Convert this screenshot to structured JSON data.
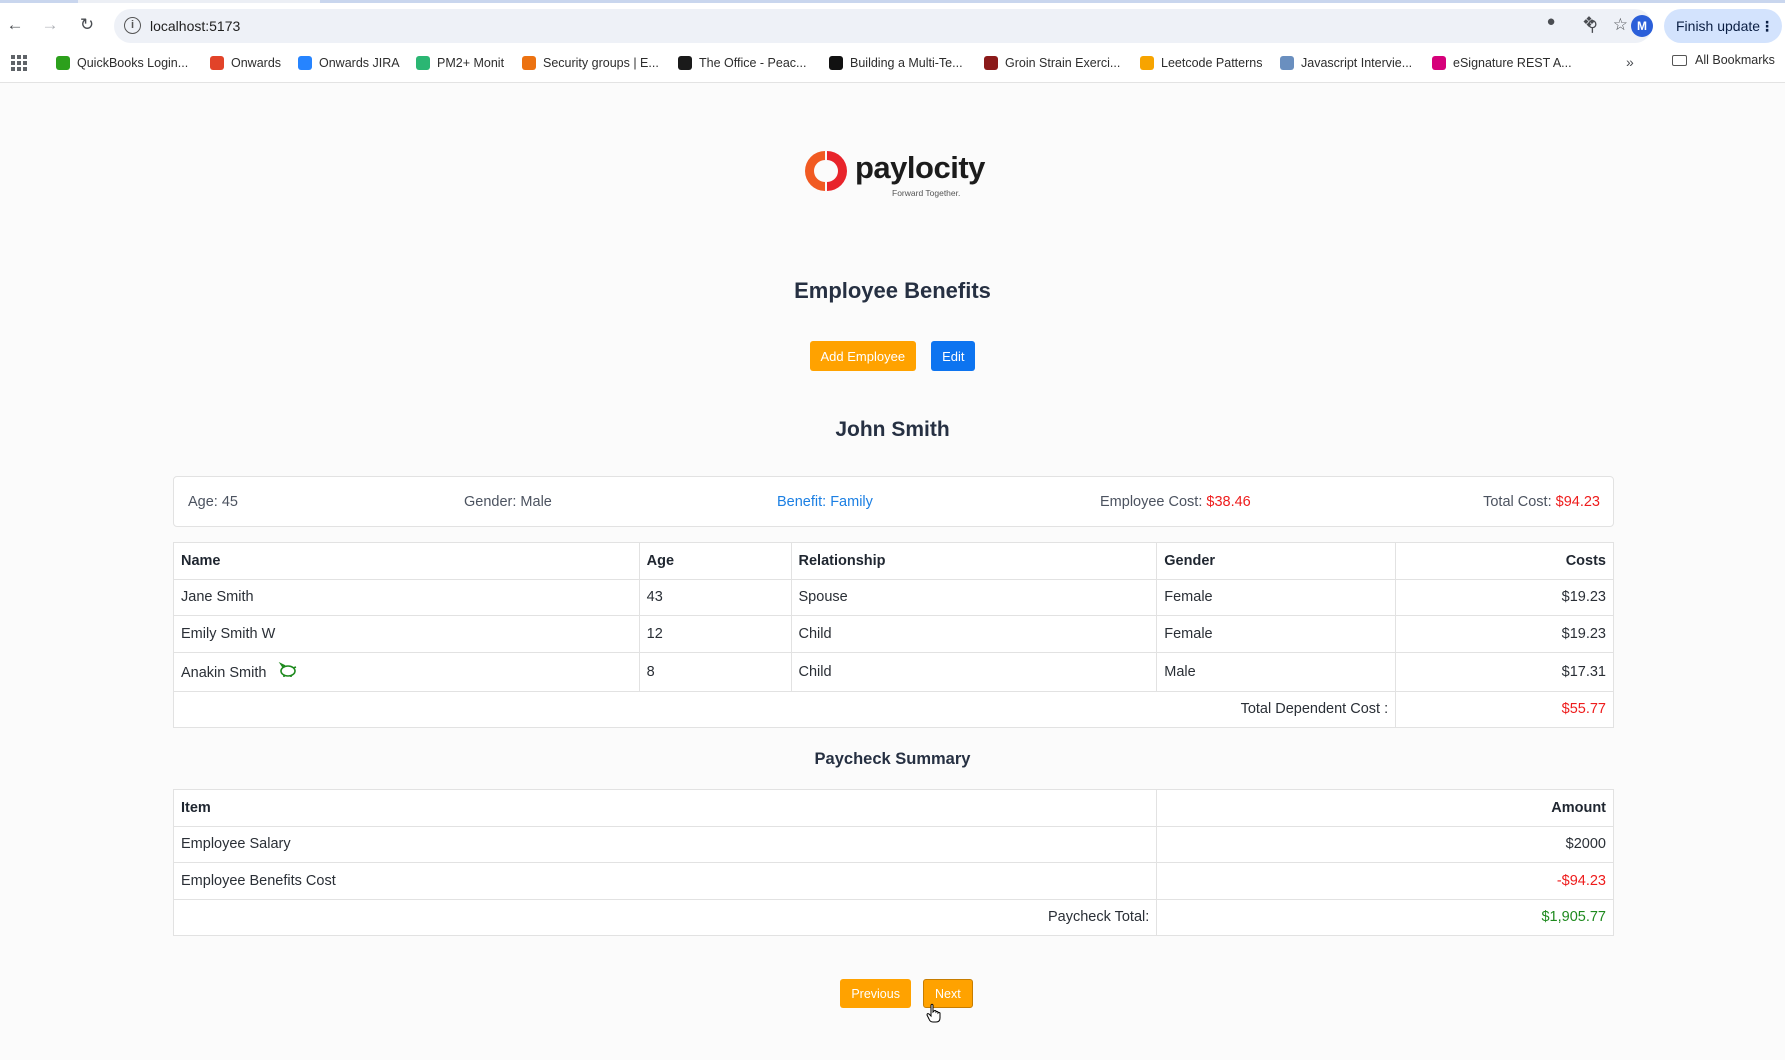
{
  "browser": {
    "url": "localhost:5173",
    "update_label": "Finish update",
    "profile_initial": "M",
    "bookmarks": [
      {
        "label": "QuickBooks Login...",
        "color": "#2ca01c"
      },
      {
        "label": "Onwards",
        "color": "#e24329"
      },
      {
        "label": "Onwards JIRA",
        "color": "#2684ff"
      },
      {
        "label": "PM2+ Monit",
        "color": "#2bb673"
      },
      {
        "label": "Security groups | E...",
        "color": "#ec7211"
      },
      {
        "label": "The Office - Peac...",
        "color": "#1a1a1a"
      },
      {
        "label": "Building a Multi-Te...",
        "color": "#111111"
      },
      {
        "label": "Groin Strain Exerci...",
        "color": "#8b1a1a"
      },
      {
        "label": "Leetcode Patterns",
        "color": "#f7a400"
      },
      {
        "label": "Javascript Intervie...",
        "color": "#6a8fbf"
      },
      {
        "label": "eSignature REST A...",
        "color": "#d6007a"
      }
    ],
    "all_bookmarks_label": "All Bookmarks"
  },
  "logo": {
    "brand": "paylocity",
    "tagline": "Forward Together."
  },
  "page": {
    "title": "Employee Benefits",
    "add_employee_label": "Add Employee",
    "edit_label": "Edit"
  },
  "employee": {
    "name": "John Smith",
    "age_label": "Age: 45",
    "gender_label": "Gender: Male",
    "benefit_label": "Benefit: Family",
    "employee_cost_label": "Employee Cost:",
    "employee_cost_value": "$38.46",
    "total_cost_label": "Total Cost:",
    "total_cost_value": "$94.23"
  },
  "dependents": {
    "headers": {
      "name": "Name",
      "age": "Age",
      "relationship": "Relationship",
      "gender": "Gender",
      "costs": "Costs"
    },
    "rows": [
      {
        "name": "Jane Smith",
        "age": "43",
        "relationship": "Spouse",
        "gender": "Female",
        "cost": "$19.23"
      },
      {
        "name": "Emily Smith W",
        "age": "12",
        "relationship": "Child",
        "gender": "Female",
        "cost": "$19.23"
      },
      {
        "name": "Anakin Smith",
        "age": "8",
        "relationship": "Child",
        "gender": "Male",
        "cost": "$17.31",
        "icon": "piggy-bank-icon"
      }
    ],
    "total_label": "Total Dependent Cost :",
    "total_value": "$55.77"
  },
  "paycheck": {
    "title": "Paycheck Summary",
    "headers": {
      "item": "Item",
      "amount": "Amount"
    },
    "rows": [
      {
        "item": "Employee Salary",
        "amount": "$2000"
      },
      {
        "item": "Employee Benefits Cost",
        "amount": "-$94.23"
      }
    ],
    "total_label": "Paycheck Total:",
    "total_value": "$1,905.77"
  },
  "pager": {
    "previous_label": "Previous",
    "next_label": "Next"
  },
  "colors": {
    "accent_orange": "#ffa200",
    "accent_blue": "#0d74f0",
    "cost_red": "#ee1c1c",
    "total_green": "#1e8a1e"
  }
}
